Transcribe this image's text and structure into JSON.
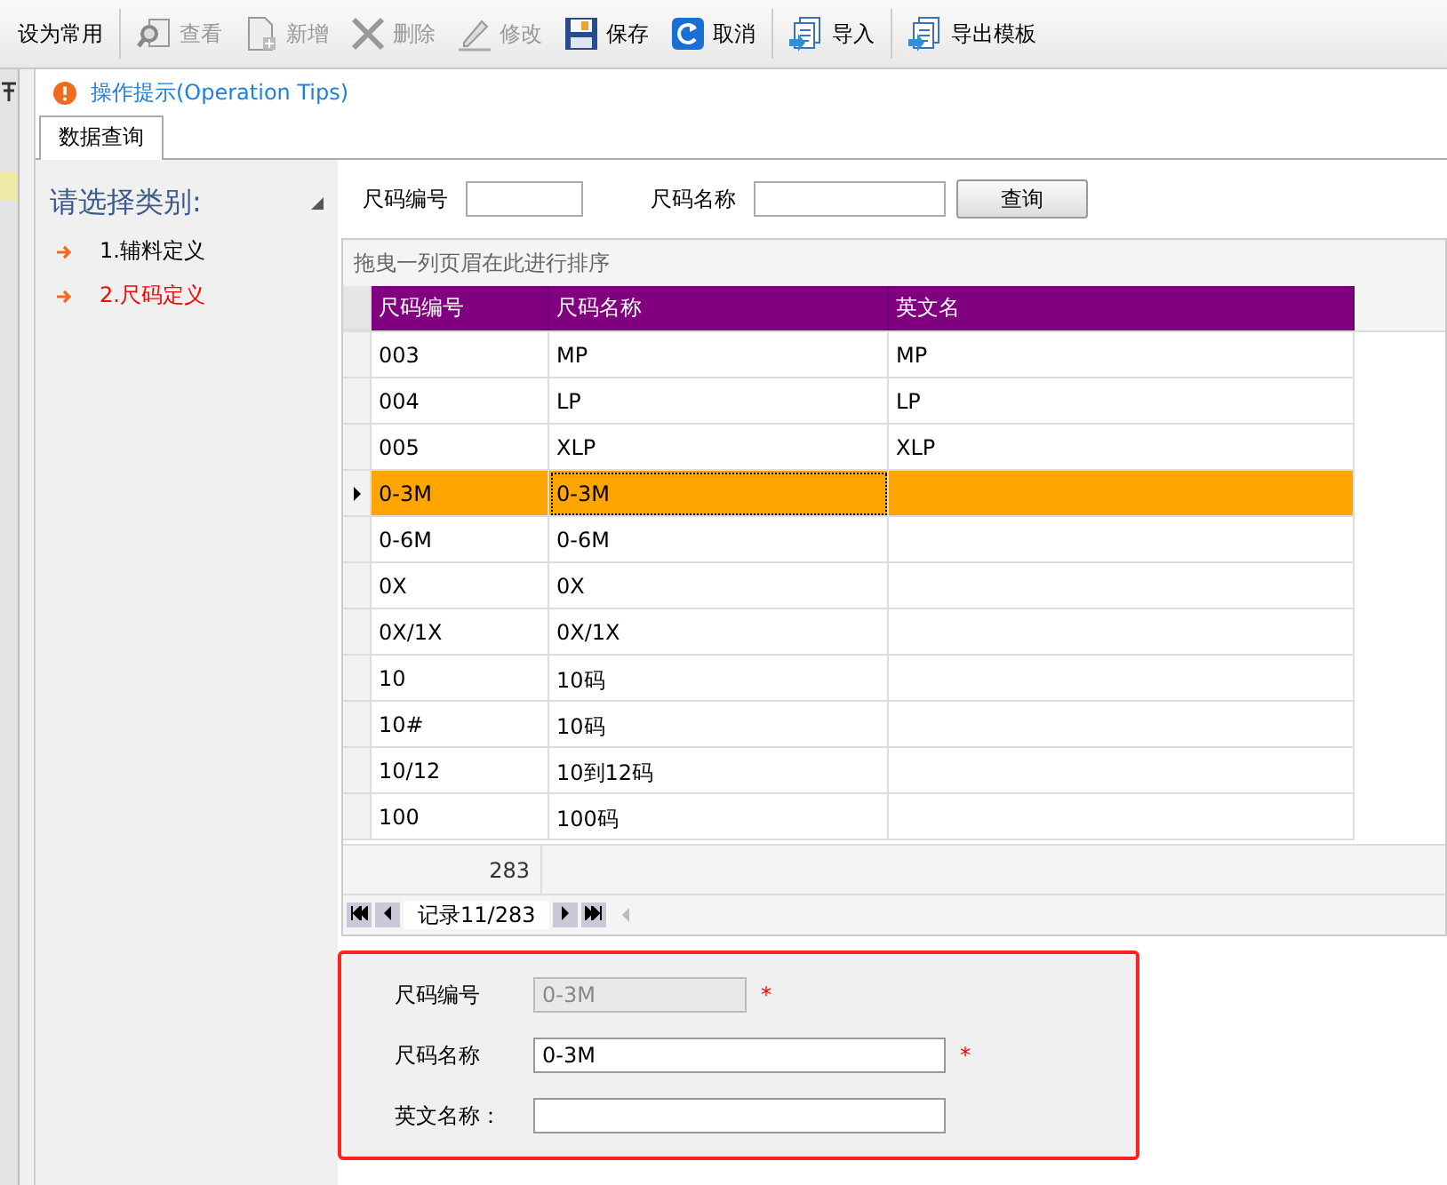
{
  "toolbar": [
    {
      "label": "设为常用",
      "kind": "none",
      "disabled": false
    },
    {
      "label": "查看",
      "kind": "view",
      "disabled": true
    },
    {
      "label": "新增",
      "kind": "new",
      "disabled": true
    },
    {
      "label": "删除",
      "kind": "delete",
      "disabled": true
    },
    {
      "label": "修改",
      "kind": "edit",
      "disabled": true
    },
    {
      "label": "保存",
      "kind": "save",
      "disabled": false
    },
    {
      "label": "取消",
      "kind": "cancel",
      "disabled": false
    },
    {
      "label": "导入",
      "kind": "import",
      "disabled": false
    },
    {
      "label": "导出模板",
      "kind": "import",
      "disabled": false
    }
  ],
  "tip": "操作提示(Operation Tips)",
  "tabs": [
    {
      "label": "数据查询",
      "selected": true
    }
  ],
  "category": {
    "title": "请选择类别:",
    "items": [
      {
        "label": "1.辅料定义",
        "selected": false
      },
      {
        "label": "2.尺码定义",
        "selected": true
      }
    ]
  },
  "search": [
    {
      "label": "尺码编号"
    },
    {
      "label": "尺码名称"
    }
  ],
  "search_button": "查询",
  "group_hint": "拖曳一列页眉在此进行排序",
  "table": {
    "columns": [
      "尺码编号",
      "尺码名称",
      "英文名"
    ],
    "rows": [
      {
        "cells": [
          "003",
          "MP",
          "MP"
        ],
        "selected": false
      },
      {
        "cells": [
          "004",
          "LP",
          "LP"
        ],
        "selected": false
      },
      {
        "cells": [
          "005",
          "XLP",
          "XLP"
        ],
        "selected": false
      },
      {
        "cells": [
          "0-3M",
          "0-3M",
          ""
        ],
        "selected": true
      },
      {
        "cells": [
          "0-6M",
          "0-6M",
          ""
        ],
        "selected": false
      },
      {
        "cells": [
          "0X",
          "0X",
          ""
        ],
        "selected": false
      },
      {
        "cells": [
          "0X/1X",
          "0X/1X",
          ""
        ],
        "selected": false
      },
      {
        "cells": [
          "10",
          "10码",
          ""
        ],
        "selected": false
      },
      {
        "cells": [
          "10#",
          "10码",
          ""
        ],
        "selected": false
      },
      {
        "cells": [
          "10/12",
          "10到12码",
          ""
        ],
        "selected": false
      },
      {
        "cells": [
          "100",
          "100码",
          ""
        ],
        "selected": false
      }
    ],
    "footer_count": "283",
    "record": "记录11/283"
  },
  "form": [
    {
      "label": "尺码编号",
      "value": "0-3M",
      "disabled": true,
      "required": true
    },
    {
      "label": "尺码名称",
      "value": "0-3M",
      "disabled": false,
      "required": true
    },
    {
      "label": "英文名称：",
      "disabled": false,
      "required": false
    }
  ],
  "required_mark": "*"
}
